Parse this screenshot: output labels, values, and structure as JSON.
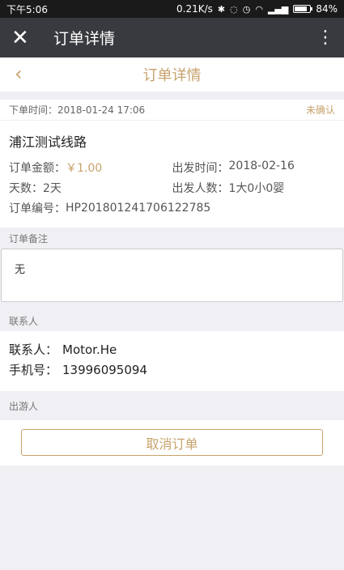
{
  "statusbar": {
    "time": "下午5:06",
    "speed": "0.21K/s",
    "battery_text": "84%",
    "battery_level": 0.84
  },
  "wechat_bar": {
    "title": "订单详情",
    "close_icon": "close-icon",
    "more_icon": "more-vertical-icon"
  },
  "page_header": {
    "title": "订单详情",
    "back_icon": "chevron-left-icon"
  },
  "order": {
    "time_label": "下单时间：",
    "time_value": "2018-01-24 17:06",
    "status": "未确认",
    "route_name": "浦江测试线路",
    "amount_label": "订单金额：",
    "amount_value": "￥1.00",
    "depart_time_label": "出发时间：",
    "depart_time_value": "2018-02-16",
    "days_label": "天数：",
    "days_value": "2天",
    "people_label": "出发人数：",
    "people_value": "1大0小0婴",
    "number_label": "订单编号：",
    "number_value": "HP201801241706122785"
  },
  "remark": {
    "section_title": "订单备注",
    "content": "无"
  },
  "contact": {
    "section_title": "联系人",
    "name_label": "联系人：",
    "name_value": "Motor.He",
    "phone_label": "手机号：",
    "phone_value": "13996095094"
  },
  "travelers": {
    "section_title": "出游人"
  },
  "actions": {
    "cancel_label": "取消订单"
  },
  "colors": {
    "accent": "#c7a26b",
    "nav_bar": "#393a3f",
    "background": "#efeff4"
  }
}
